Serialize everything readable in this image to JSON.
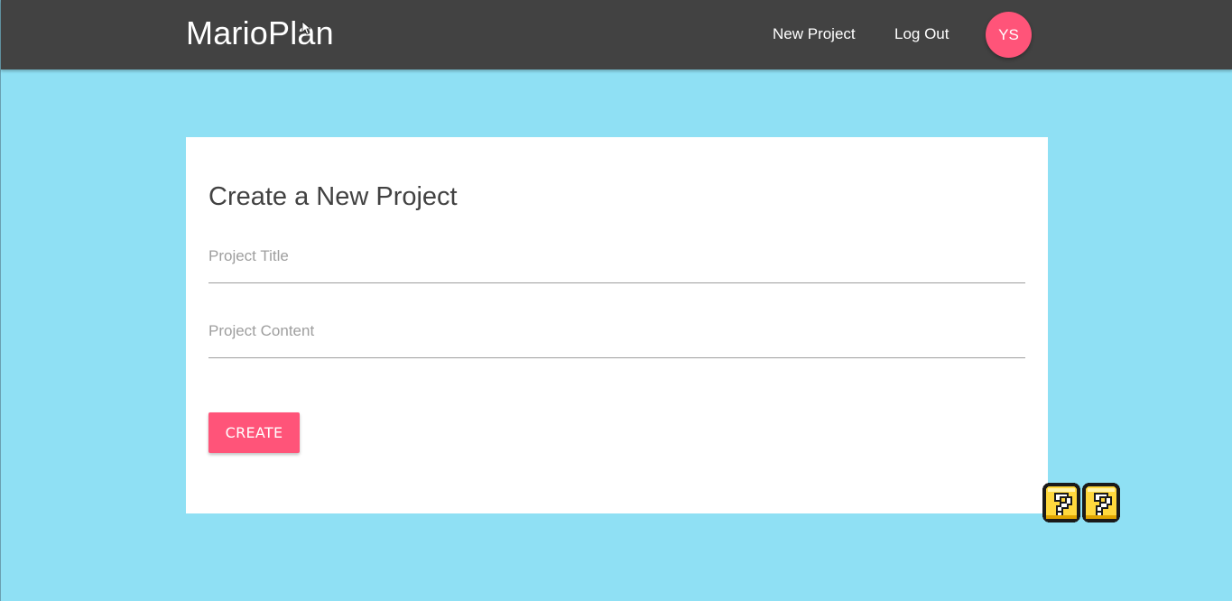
{
  "navbar": {
    "brand": "MarioPlan",
    "links": [
      {
        "label": "New Project"
      },
      {
        "label": "Log Out"
      }
    ],
    "avatar_initials": "YS"
  },
  "form": {
    "title": "Create a New Project",
    "fields": [
      {
        "placeholder": "Project Title",
        "value": ""
      },
      {
        "placeholder": "Project Content",
        "value": ""
      }
    ],
    "submit_label": "CREATE"
  },
  "decorations": {
    "question_blocks": [
      "question-block-icon",
      "question-block-icon"
    ]
  },
  "colors": {
    "page_background": "#8fe0f4",
    "navbar_background": "#424242",
    "accent": "#ff5479",
    "card_background": "#ffffff",
    "question_block_fill": "#ffd83d"
  }
}
